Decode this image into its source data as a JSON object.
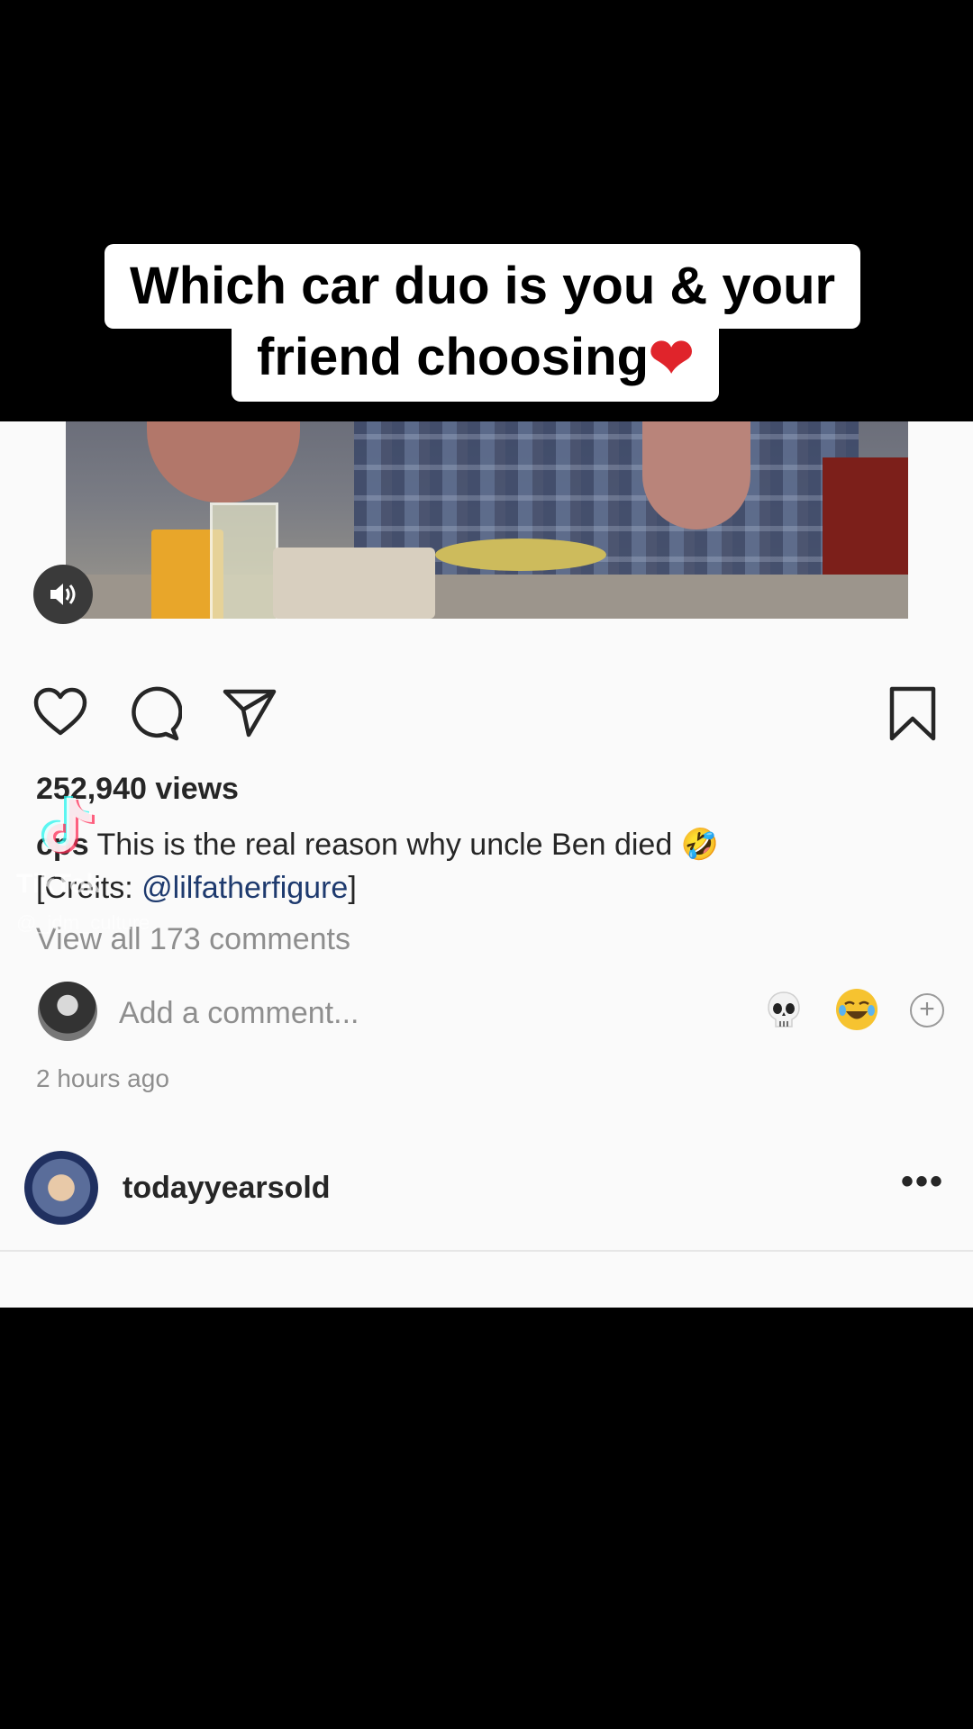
{
  "caption_overlay": {
    "line1": "Which car duo is you & your",
    "line2": "friend choosing",
    "line2_emoji": "❤"
  },
  "post": {
    "views": "252,940 views",
    "caption_user": "c",
    "caption_user_suffix": "ps",
    "caption_text": " This is the real reason why uncle Ben died 🤣",
    "credits_prefix": "[Cre",
    "credits_mid": "its: ",
    "credits_mention": "@lilfatherfigure",
    "credits_suffix": "]",
    "view_all": "View all 173 comments",
    "add_comment_placeholder": "Add a comment...",
    "time_ago": "2 hours ago"
  },
  "next_post": {
    "username": "todayyearsold",
    "more": "•••"
  },
  "watermark": {
    "brand": "TikTok",
    "handle": "@_jdm_culture"
  },
  "icons": [
    "heart-icon",
    "comment-icon",
    "share-icon",
    "bookmark-icon",
    "sound-icon",
    "skull-emoji",
    "laugh-emoji",
    "plus-circle-icon",
    "tiktok-logo"
  ],
  "colors": {
    "background": "#000000",
    "panel": "#fafafa",
    "text": "#262626",
    "muted": "#8e8e8e",
    "mention": "#1e3a6e"
  }
}
